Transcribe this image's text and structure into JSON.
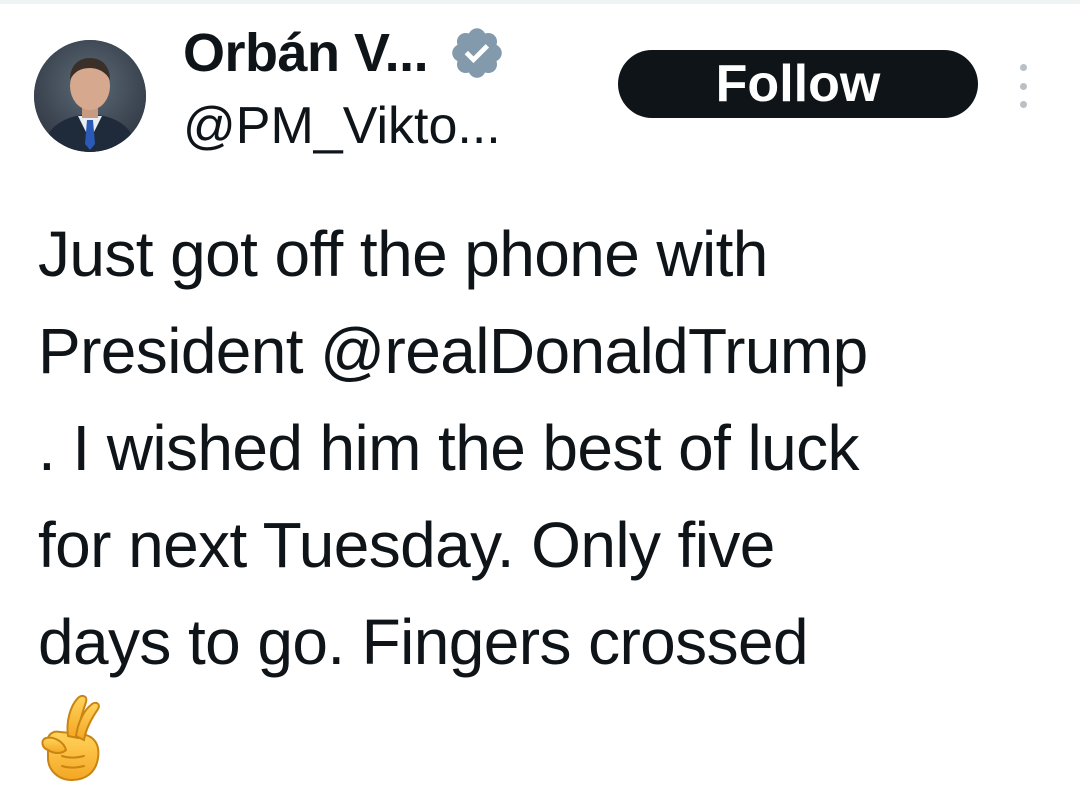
{
  "author": {
    "display_name": "Orbán V...",
    "handle": "@PM_Vikto...",
    "verified_icon": "verified-badge-icon",
    "verified_color": "#829aab"
  },
  "actions": {
    "follow_label": "Follow",
    "more_icon": "more-vertical-icon"
  },
  "tweet": {
    "lines": [
      "Just got off the phone with",
      "President @realDonaldTrump",
      ". I wished him the best of luck",
      "for next Tuesday. Only five",
      "days to go. Fingers crossed"
    ],
    "emoji": "crossed-fingers-emoji"
  },
  "colors": {
    "text": "#0f1419",
    "follow_bg": "#0f1419",
    "follow_text": "#ffffff"
  }
}
